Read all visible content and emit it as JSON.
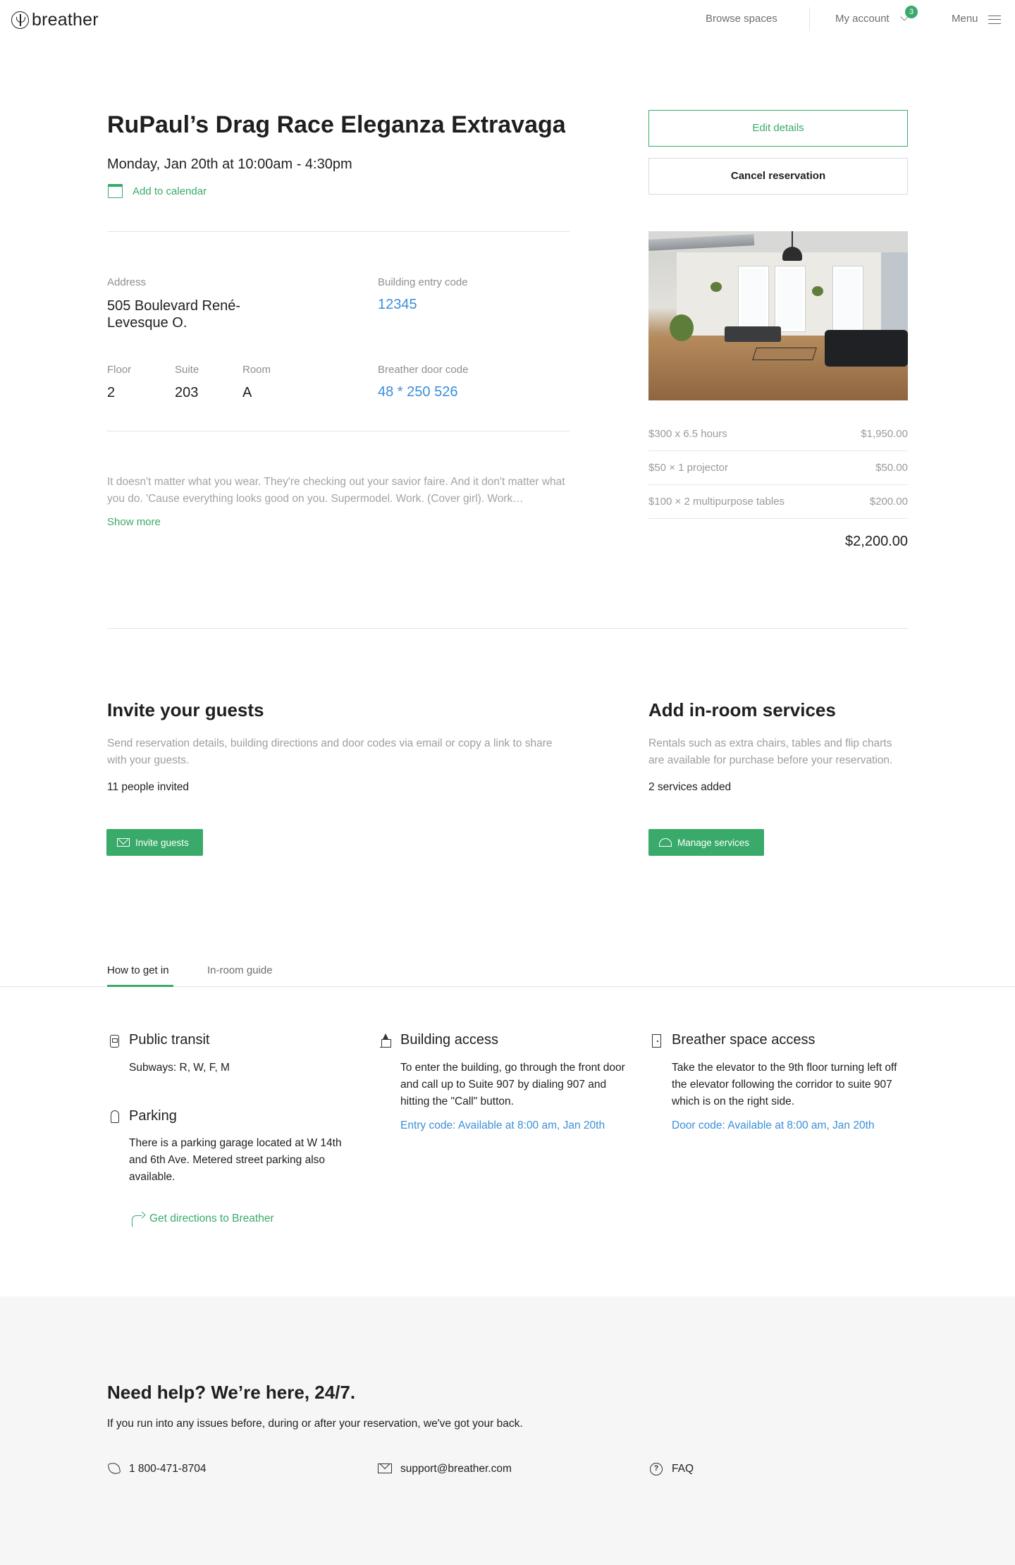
{
  "header": {
    "brand": "breather",
    "nav": {
      "browse": "Browse spaces",
      "account": "My account",
      "account_badge": "3",
      "menu": "Menu"
    }
  },
  "reservation": {
    "title": "RuPaul’s Drag Race Eleganza Extravaganz…",
    "datetime": "Monday, Jan 20th at 10:00am - 4:30pm",
    "add_to_calendar": "Add to calendar",
    "address_label": "Address",
    "address_value": "505 Boulevard René-Levesque O.",
    "entry_code_label": "Building entry code",
    "entry_code_value": "12345",
    "floor_label": "Floor",
    "floor_value": "2",
    "suite_label": "Suite",
    "suite_value": "203",
    "room_label": "Room",
    "room_value": "A",
    "door_code_label": "Breather door code",
    "door_code_value": "48 * 250 526",
    "description": "It doesn't matter what you wear. They're checking out your savior faire. And it don't matter what you do. 'Cause everything looks good on you. Supermodel. Work. (Cover girl). Work…",
    "show_more": "Show more"
  },
  "actions": {
    "edit": "Edit details",
    "cancel": "Cancel reservation"
  },
  "pricing": {
    "rows": [
      {
        "label": "$300 x  6.5 hours",
        "amount": "$1,950.00"
      },
      {
        "label": "$50 × 1 projector",
        "amount": "$50.00"
      },
      {
        "label": "$100 × 2 multipurpose tables",
        "amount": "$200.00"
      }
    ],
    "total": "$2,200.00"
  },
  "invite": {
    "title": "Invite your guests",
    "description": "Send reservation details, building directions and door codes via email or copy a link to share with your guests.",
    "status": "11 people invited",
    "button": "Invite guests"
  },
  "services": {
    "title": "Add in-room services",
    "description": "Rentals such as extra chairs, tables and flip charts are available for purchase before your reservation.",
    "status": "2 services added",
    "button": "Manage services"
  },
  "tabs": {
    "items": [
      "How to get in",
      "In-room guide"
    ],
    "active": "How to get in"
  },
  "directions": {
    "transit": {
      "title": "Public transit",
      "text": "Subways: R, W, F, M"
    },
    "parking": {
      "title": "Parking",
      "text": "There is a parking garage located at W 14th and 6th Ave. Metered street parking also available."
    },
    "get_directions": "Get directions to Breather",
    "building": {
      "title": "Building access",
      "text": "To enter the building, go through the front door and call up to Suite 907 by dialing 907 and hitting the \"Call\" button.",
      "code": "Entry code: Available at 8:00 am, Jan 20th"
    },
    "space": {
      "title": "Breather space access",
      "text": "Take the elevator to the 9th floor turning left off the elevator following the corridor to suite 907 which is on the right side.",
      "code": "Door code: Available at 8:00 am, Jan 20th"
    }
  },
  "help": {
    "title": "Need help? We’re here, 24/7.",
    "subtitle": "If you run into any issues before, during or after your reservation, we've got your back.",
    "phone": "1 800-471-8704",
    "email": "support@breather.com",
    "faq": "FAQ"
  },
  "colors": {
    "accent_green": "#3aaa6b",
    "link_blue": "#3a8fd8"
  }
}
